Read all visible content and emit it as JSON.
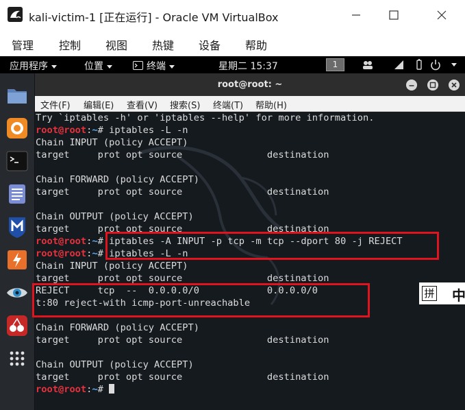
{
  "vbox": {
    "title": "kali-victim-1 [正在运行] - Oracle VM VirtualBox",
    "menu": [
      "管理",
      "控制",
      "视图",
      "热键",
      "设备",
      "帮助"
    ]
  },
  "kali_topbar": {
    "applications": "应用程序",
    "places": "位置",
    "terminal": "终端",
    "clock": "星期二 15:37",
    "workspace": "1"
  },
  "dock": [
    "file-manager",
    "firefox",
    "terminal",
    "text-editor",
    "metasploit",
    "burpsuite",
    "maltego-eye",
    "cherrytree",
    "show-applications"
  ],
  "terminal": {
    "title": "root@root: ~",
    "menu": [
      "文件(F)",
      "编辑(E)",
      "查看(V)",
      "搜索(S)",
      "终端(T)",
      "帮助(H)"
    ],
    "prompt": {
      "user": "root@root",
      "sep": ":",
      "path": "~",
      "symbol": "# "
    },
    "lines": [
      {
        "type": "out",
        "text": "Try `iptables -h' or 'iptables --help' for more information."
      },
      {
        "type": "cmd",
        "text": "iptables -L -n"
      },
      {
        "type": "out",
        "text": "Chain INPUT (policy ACCEPT)"
      },
      {
        "type": "out",
        "text": "target     prot opt source               destination"
      },
      {
        "type": "out",
        "text": ""
      },
      {
        "type": "out",
        "text": "Chain FORWARD (policy ACCEPT)"
      },
      {
        "type": "out",
        "text": "target     prot opt source               destination"
      },
      {
        "type": "out",
        "text": ""
      },
      {
        "type": "out",
        "text": "Chain OUTPUT (policy ACCEPT)"
      },
      {
        "type": "out",
        "text": "target     prot opt source               destination"
      },
      {
        "type": "cmd",
        "text": "iptables -A INPUT -p tcp -m tcp --dport 80 -j REJECT"
      },
      {
        "type": "cmd",
        "text": "iptables -L -n"
      },
      {
        "type": "out",
        "text": "Chain INPUT (policy ACCEPT)"
      },
      {
        "type": "out",
        "text": "target     prot opt source               destination"
      },
      {
        "type": "out",
        "text": "REJECT     tcp  --  0.0.0.0/0            0.0.0.0/0"
      },
      {
        "type": "out",
        "text": "t:80 reject-with icmp-port-unreachable"
      },
      {
        "type": "out",
        "text": ""
      },
      {
        "type": "out",
        "text": "Chain FORWARD (policy ACCEPT)"
      },
      {
        "type": "out",
        "text": "target     prot opt source               destination"
      },
      {
        "type": "out",
        "text": ""
      },
      {
        "type": "out",
        "text": "Chain OUTPUT (policy ACCEPT)"
      },
      {
        "type": "out",
        "text": "target     prot opt source               destination"
      },
      {
        "type": "cmd",
        "text": ""
      }
    ]
  },
  "ime": {
    "mode": "拼",
    "lang": "中"
  },
  "colors": {
    "prompt_user": "#e8313c",
    "prompt_path": "#5aa9f0",
    "annotation": "#e0141e",
    "terminal_bg": "#151a1f"
  }
}
